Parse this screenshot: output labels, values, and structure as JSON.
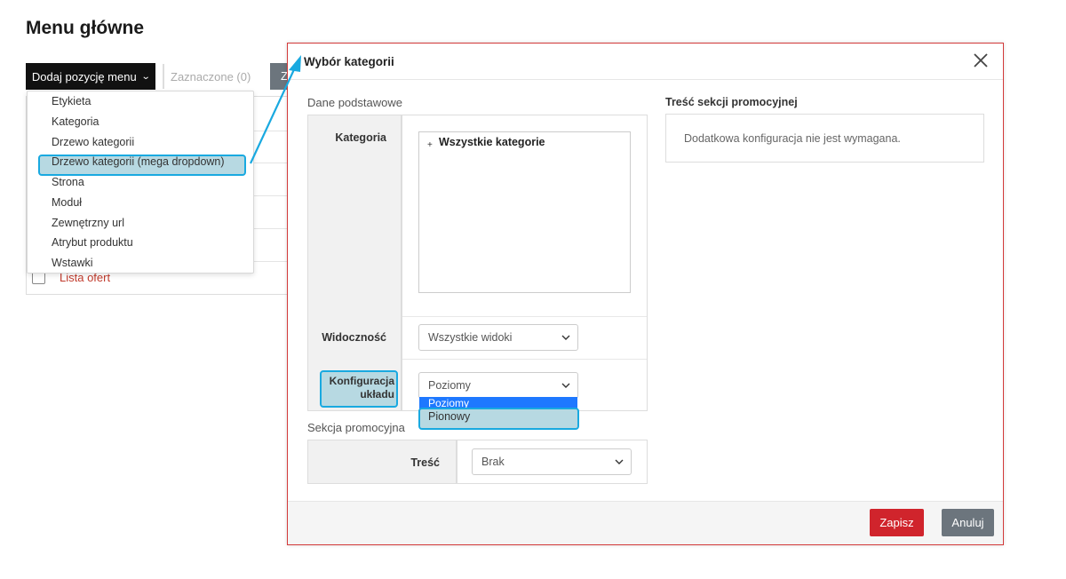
{
  "page": {
    "title": "Menu główne"
  },
  "toolbar": {
    "add_label": "Dodaj pozycję menu",
    "selected_label": "Zaznaczone (0)",
    "grey_button_label": "Z"
  },
  "add_menu": {
    "items": [
      "Etykieta",
      "Kategoria",
      "Drzewo kategorii",
      "Drzewo kategorii (mega dropdown)",
      "Strona",
      "Moduł",
      "Zewnętrzny url",
      "Atrybut produktu",
      "Wstawki"
    ],
    "highlighted_index": 3
  },
  "list": {
    "offer_row_label": "Lista ofert"
  },
  "modal": {
    "title": "Wybór kategorii",
    "basic_section_label": "Dane podstawowe",
    "category_label": "Kategoria",
    "tree_root_label": "Wszystkie kategorie",
    "visibility_label": "Widoczność",
    "visibility_value": "Wszystkie widoki",
    "layout_label": "Konfiguracja układu",
    "layout_value": "Poziomy",
    "layout_options": [
      "Poziomy",
      "Pionowy"
    ],
    "promo_section_label": "Sekcja promocyjna",
    "content_label": "Treść",
    "content_value": "Brak",
    "promo_content_title": "Treść sekcji promocyjnej",
    "promo_content_text": "Dodatkowa konfiguracja nie jest wymagana.",
    "save_label": "Zapisz",
    "cancel_label": "Anuluj"
  },
  "colors": {
    "accent": "#19a9e0",
    "highlight": "#b7d9e2",
    "danger": "#d0242c",
    "secondary": "#6c757d",
    "option_blue": "#1e78ff"
  }
}
